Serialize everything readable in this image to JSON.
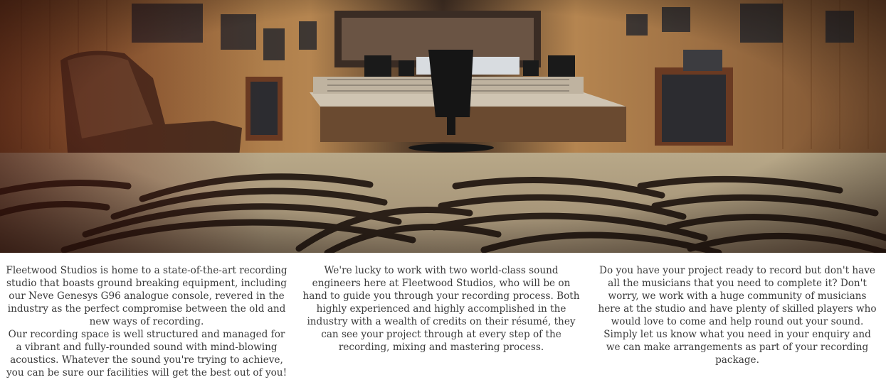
{
  "hero": {
    "image_description_icon": "studio-photo",
    "colors": {
      "wood": "#b07a45",
      "shadow": "#2a160c",
      "carpet_light": "#c8b9a0",
      "carpet_dark": "#2b2018",
      "console": "#d8cfc0"
    }
  },
  "columns": [
    {
      "paragraphs": [
        "Fleetwood Studios is home to a state-of-the-art recording studio that boasts ground breaking equipment, including our Neve Genesys G96 analogue console, revered in the industry as the perfect compromise between the old and new ways of recording.",
        "Our recording space is well structured and managed for a vibrant and fully-rounded sound with mind-blowing acoustics. Whatever the sound you're trying to achieve, you can be sure our facilities will get the best out of you!"
      ]
    },
    {
      "paragraphs": [
        "We're lucky to work with two world-class sound engineers here at Fleetwood Studios, who will be on hand to guide you through your recording process. Both highly experienced and highly accomplished in the industry with a wealth of credits on their résumé, they can see your project through at every step of the recording, mixing and mastering process."
      ]
    },
    {
      "paragraphs": [
        "Do you have your project ready to record but don't have all the musicians that you need to complete it? Don't worry, we work with a huge community of musicians here at the studio and have plenty of skilled players who would love to come and help round out your sound. Simply let us know what you need in your enquiry and we can make arrangements as part of your recording package."
      ]
    }
  ]
}
